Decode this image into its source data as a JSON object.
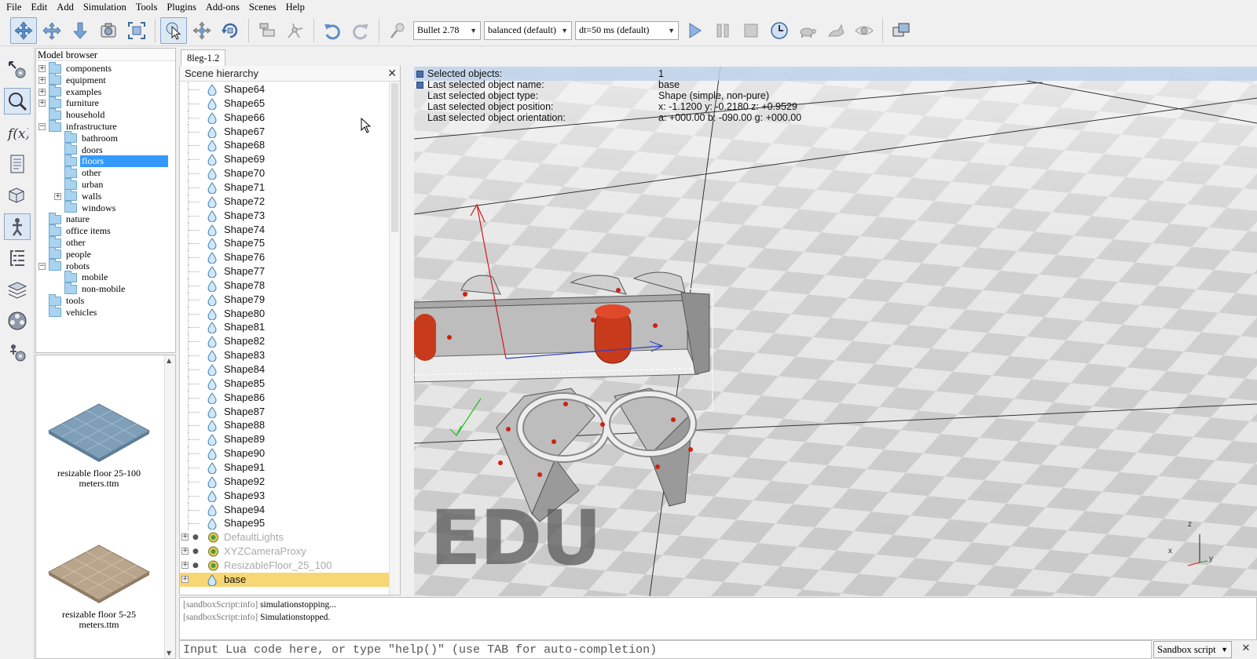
{
  "menubar": {
    "items": [
      "File",
      "Edit",
      "Add",
      "Simulation",
      "Tools",
      "Plugins",
      "Add-ons",
      "Scenes",
      "Help"
    ]
  },
  "toolbar": {
    "engine": "Bullet 2.78",
    "mode": "balanced (default)",
    "dt": "dt=50 ms (default)"
  },
  "model_browser": {
    "title": "Model browser",
    "items": [
      {
        "label": "components",
        "expander": "+",
        "depth": 0
      },
      {
        "label": "equipment",
        "expander": "+",
        "depth": 0
      },
      {
        "label": "examples",
        "expander": "+",
        "depth": 0
      },
      {
        "label": "furniture",
        "expander": "+",
        "depth": 0
      },
      {
        "label": "household",
        "expander": "",
        "depth": 0
      },
      {
        "label": "infrastructure",
        "expander": "−",
        "depth": 0
      },
      {
        "label": "bathroom",
        "expander": "",
        "depth": 1
      },
      {
        "label": "doors",
        "expander": "",
        "depth": 1
      },
      {
        "label": "floors",
        "expander": "",
        "depth": 1,
        "selected": true
      },
      {
        "label": "other",
        "expander": "",
        "depth": 1
      },
      {
        "label": "urban",
        "expander": "",
        "depth": 1
      },
      {
        "label": "walls",
        "expander": "+",
        "depth": 1
      },
      {
        "label": "windows",
        "expander": "",
        "depth": 1
      },
      {
        "label": "nature",
        "expander": "",
        "depth": 0
      },
      {
        "label": "office items",
        "expander": "",
        "depth": 0
      },
      {
        "label": "other",
        "expander": "",
        "depth": 0
      },
      {
        "label": "people",
        "expander": "",
        "depth": 0
      },
      {
        "label": "robots",
        "expander": "−",
        "depth": 0
      },
      {
        "label": "mobile",
        "expander": "",
        "depth": 1
      },
      {
        "label": "non-mobile",
        "expander": "",
        "depth": 1
      },
      {
        "label": "tools",
        "expander": "",
        "depth": 0
      },
      {
        "label": "vehicles",
        "expander": "",
        "depth": 0
      }
    ]
  },
  "thumbnails": [
    {
      "caption": "resizable floor 25-100 meters.ttm",
      "color": "#7f9fb8"
    },
    {
      "caption": "resizable floor 5-25 meters.ttm",
      "color": "#b8a58c"
    }
  ],
  "view_tab": "8leg-1.2",
  "hierarchy": {
    "title": "Scene hierarchy",
    "shapes": [
      "Shape64",
      "Shape65",
      "Shape66",
      "Shape67",
      "Shape68",
      "Shape69",
      "Shape70",
      "Shape71",
      "Shape72",
      "Shape73",
      "Shape74",
      "Shape75",
      "Shape76",
      "Shape77",
      "Shape78",
      "Shape79",
      "Shape80",
      "Shape81",
      "Shape82",
      "Shape83",
      "Shape84",
      "Shape85",
      "Shape86",
      "Shape87",
      "Shape88",
      "Shape89",
      "Shape90",
      "Shape91",
      "Shape92",
      "Shape93",
      "Shape94",
      "Shape95"
    ],
    "objects": [
      {
        "name": "DefaultLights",
        "dim": true
      },
      {
        "name": "XYZCameraProxy",
        "dim": true
      },
      {
        "name": "ResizableFloor_25_100",
        "dim": true
      },
      {
        "name": "base",
        "dim": false,
        "selected": true
      }
    ]
  },
  "info": {
    "rows": [
      {
        "k": "Selected objects:",
        "v": "1"
      },
      {
        "k": "Last selected object name:",
        "v": "base"
      },
      {
        "k": "Last selected object type:",
        "v": "Shape (simple, non-pure)"
      },
      {
        "k": "Last selected object position:",
        "v": "x: -1.1200    y: -0.2180    z: +0.9529"
      },
      {
        "k": "Last selected object orientation:",
        "v": "a: +000.00    b: -090.00    g: +000.00"
      }
    ]
  },
  "watermark": "EDU",
  "axes": {
    "z": "z",
    "x": "x",
    "y": "y"
  },
  "console": {
    "lines": [
      {
        "tag": "[sandboxScript:info]",
        "text": " simulationstopping..."
      },
      {
        "tag": "[sandboxScript:info]",
        "text": " Simulationstopped."
      }
    ],
    "placeholder": "Input Lua code here, or type \"help()\" (use TAB for auto-completion)",
    "script_selector": "Sandbox script"
  }
}
